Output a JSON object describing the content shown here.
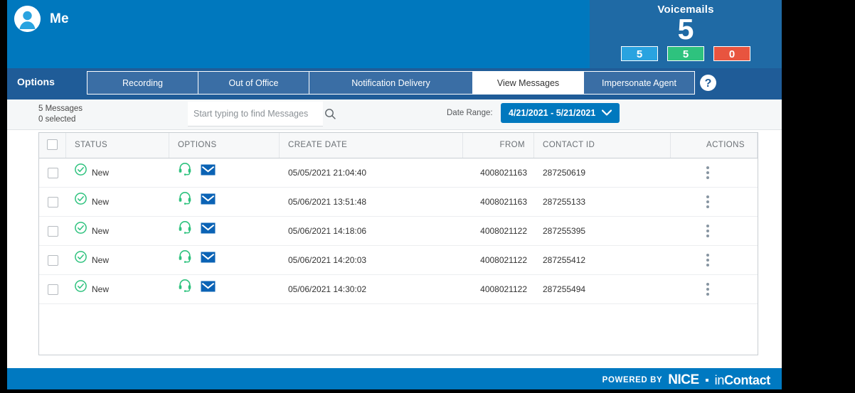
{
  "header": {
    "avatar_icon": "user-avatar-icon",
    "title": "Me",
    "voicemails": {
      "label": "Voicemails",
      "total": "5",
      "badges": [
        {
          "name": "new",
          "value": "5",
          "color": "#29a3e0"
        },
        {
          "name": "saved",
          "value": "5",
          "color": "#2ec27e"
        },
        {
          "name": "deleted",
          "value": "0",
          "color": "#e8543f"
        }
      ]
    }
  },
  "tabbar": {
    "options_label": "Options",
    "help_icon": "help-question-icon",
    "tabs": [
      {
        "label": "Recording",
        "active": false
      },
      {
        "label": "Out of Office",
        "active": false
      },
      {
        "label": "Notification Delivery",
        "active": false
      },
      {
        "label": "View Messages",
        "active": true
      },
      {
        "label": "Impersonate Agent",
        "active": false
      }
    ]
  },
  "toolbar": {
    "message_count": "5 Messages",
    "selected_count": "0 selected",
    "search_placeholder": "Start typing to find Messages",
    "search_value": "",
    "search_icon": "search-icon",
    "date_range_label": "Date Range:",
    "date_range_value": "4/21/2021 - 5/21/2021",
    "date_range_chevron": "chevron-down-icon"
  },
  "table": {
    "columns": [
      "STATUS",
      "OPTIONS",
      "CREATE DATE",
      "FROM",
      "CONTACT ID",
      "ACTIONS"
    ],
    "rows": [
      {
        "status": "New",
        "create_date": "05/05/2021 21:04:40",
        "from": "4008021163",
        "contact_id": "287250619"
      },
      {
        "status": "New",
        "create_date": "05/06/2021 13:51:48",
        "from": "4008021163",
        "contact_id": "287255133"
      },
      {
        "status": "New",
        "create_date": "05/06/2021 14:18:06",
        "from": "4008021122",
        "contact_id": "287255395"
      },
      {
        "status": "New",
        "create_date": "05/06/2021 14:20:03",
        "from": "4008021122",
        "contact_id": "287255412"
      },
      {
        "status": "New",
        "create_date": "05/06/2021 14:30:02",
        "from": "4008021122",
        "contact_id": "287255494"
      }
    ],
    "row_icons": {
      "status_icon": "check-circle-icon",
      "listen_icon": "headset-icon",
      "email_icon": "envelope-icon",
      "actions_icon": "kebab-menu-icon"
    }
  },
  "footer": {
    "powered_by": "POWERED BY",
    "brand_nice": "NICE",
    "brand_in": "in",
    "brand_contact": "Contact"
  },
  "colors": {
    "header_blue": "#0078be",
    "tabbar_blue": "#1f5c98",
    "tab_blue": "#3a6ea5",
    "vm_panel_blue": "#1f6aa5",
    "accent_blue": "#0078be",
    "status_green": "#2ec27e",
    "footer_blue": "#0079c1"
  }
}
